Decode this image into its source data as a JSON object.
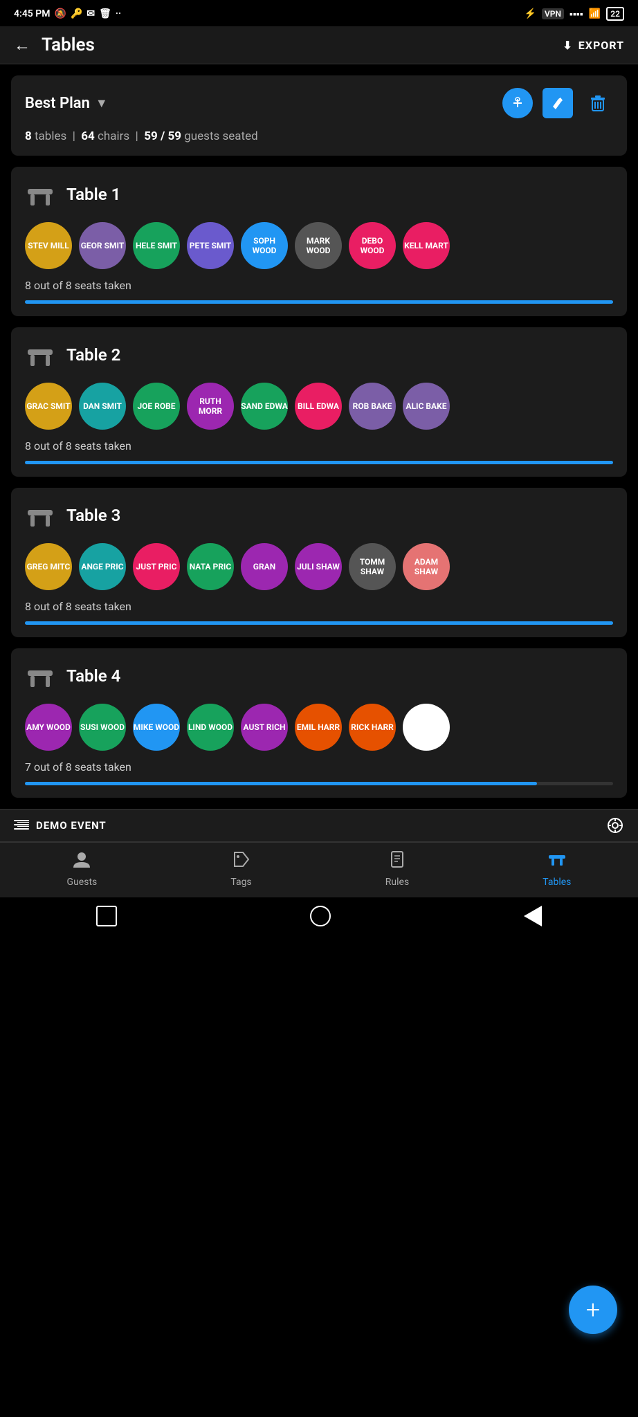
{
  "statusBar": {
    "time": "4:45 PM",
    "battery": "22"
  },
  "header": {
    "back_label": "←",
    "title": "Tables",
    "export_label": "EXPORT"
  },
  "planCard": {
    "plan_name": "Best Plan",
    "stats_tables": "8",
    "stats_chairs": "64",
    "stats_guests_seated": "59 / 59",
    "stats_label_tables": "tables",
    "stats_label_chairs": "chairs",
    "stats_label_guests": "guests seated",
    "stats_separator": "|"
  },
  "tables": [
    {
      "id": "table-1",
      "name": "Table 1",
      "seats_taken": 8,
      "seats_total": 8,
      "seats_label": "8 out of 8 seats taken",
      "progress": 100,
      "guests": [
        {
          "initials": "STEV\nMILL",
          "color": "#d4a017"
        },
        {
          "initials": "GEOR\nSMIT",
          "color": "#7b5ea7"
        },
        {
          "initials": "HELE\nSMIT",
          "color": "#17a25c"
        },
        {
          "initials": "PETE\nSMIT",
          "color": "#6a5acd"
        },
        {
          "initials": "SOPH\nWOOD",
          "color": "#2196f3"
        },
        {
          "initials": "MARK\nWOOD",
          "color": "#555"
        },
        {
          "initials": "DEBO\nWOOD",
          "color": "#e91e63"
        },
        {
          "initials": "KELL\nMART",
          "color": "#e91e63"
        }
      ]
    },
    {
      "id": "table-2",
      "name": "Table 2",
      "seats_taken": 8,
      "seats_total": 8,
      "seats_label": "8 out of 8 seats taken",
      "progress": 100,
      "guests": [
        {
          "initials": "GRAC\nSMIT",
          "color": "#d4a017"
        },
        {
          "initials": "DAN\nSMIT",
          "color": "#17a2a2"
        },
        {
          "initials": "JOE\nROBE",
          "color": "#17a25c"
        },
        {
          "initials": "RUTH\nMORR",
          "color": "#9c27b0"
        },
        {
          "initials": "SAND\nEDWA",
          "color": "#17a25c"
        },
        {
          "initials": "BILL\nEDWA",
          "color": "#e91e63"
        },
        {
          "initials": "ROB\nBAKE",
          "color": "#7b5ea7"
        },
        {
          "initials": "ALIC\nBAKE",
          "color": "#7b5ea7"
        }
      ]
    },
    {
      "id": "table-3",
      "name": "Table 3",
      "seats_taken": 8,
      "seats_total": 8,
      "seats_label": "8 out of 8 seats taken",
      "progress": 100,
      "guests": [
        {
          "initials": "GREG\nMITC",
          "color": "#d4a017"
        },
        {
          "initials": "ANGE\nPRIC",
          "color": "#17a2a2"
        },
        {
          "initials": "JUST\nPRIC",
          "color": "#e91e63"
        },
        {
          "initials": "NATA\nPRIC",
          "color": "#17a25c"
        },
        {
          "initials": "GRAN",
          "color": "#9c27b0"
        },
        {
          "initials": "JULI\nSHAW",
          "color": "#9c27b0"
        },
        {
          "initials": "TOMM\nSHAW",
          "color": "#555"
        },
        {
          "initials": "ADAM\nSHAW",
          "color": "#e57373"
        }
      ]
    },
    {
      "id": "table-4",
      "name": "Table 4",
      "seats_taken": 7,
      "seats_total": 8,
      "seats_label": "7 out of 8 seats taken",
      "progress": 87,
      "guests": [
        {
          "initials": "AMY\nWOOD",
          "color": "#9c27b0"
        },
        {
          "initials": "SUSI\nWOOD",
          "color": "#17a25c"
        },
        {
          "initials": "MIKE\nWOOD",
          "color": "#2196f3"
        },
        {
          "initials": "LIND\nWOOD",
          "color": "#17a25c"
        },
        {
          "initials": "AUST\nRICH",
          "color": "#9c27b0"
        },
        {
          "initials": "EMIL\nHARR",
          "color": "#e65100"
        },
        {
          "initials": "RICK\nHARR",
          "color": "#e65100"
        },
        {
          "initials": "",
          "color": "empty"
        }
      ]
    }
  ],
  "eventBar": {
    "event_name": "DEMO EVENT"
  },
  "navBar": {
    "items": [
      {
        "label": "Guests",
        "icon": "👤",
        "active": false
      },
      {
        "label": "Tags",
        "icon": "🏷",
        "active": false
      },
      {
        "label": "Rules",
        "icon": "📋",
        "active": false
      },
      {
        "label": "Tables",
        "icon": "🪑",
        "active": true
      }
    ]
  },
  "fab": {
    "label": "+"
  }
}
